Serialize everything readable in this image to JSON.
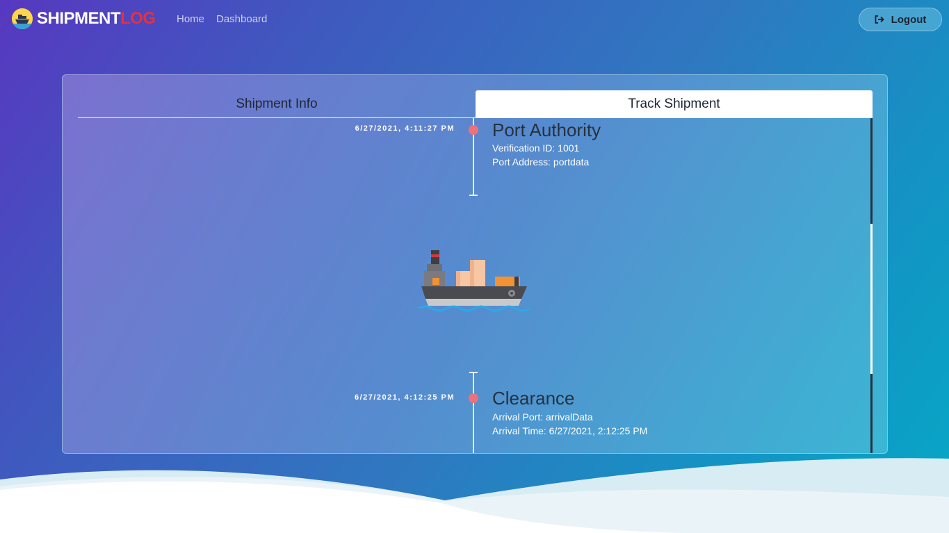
{
  "navbar": {
    "brand_part1": "SHIPMENT",
    "brand_part2": "LOG",
    "links": [
      "Home",
      "Dashboard"
    ],
    "logout_label": "Logout"
  },
  "tabs": {
    "info_label": "Shipment Info",
    "track_label": "Track Shipment"
  },
  "timeline": [
    {
      "timestamp": "6/27/2021, 4:11:27 PM",
      "title": "Port Authority",
      "details": [
        "Verification ID: 1001",
        "Port Address: portdata"
      ]
    },
    {
      "timestamp": "6/27/2021, 4:12:25 PM",
      "title": "Clearance",
      "details": [
        "Arrival Port: arrivalData",
        "Arrival Time: 6/27/2021, 2:12:25 PM"
      ]
    }
  ],
  "icons": {
    "brand": "cargo-ship-logo-icon",
    "logout": "sign-out-icon",
    "center": "cargo-ship-icon"
  },
  "colors": {
    "accent_red": "#e8303a",
    "timeline_dot": "#f0707a",
    "dark_text": "#27313f"
  }
}
